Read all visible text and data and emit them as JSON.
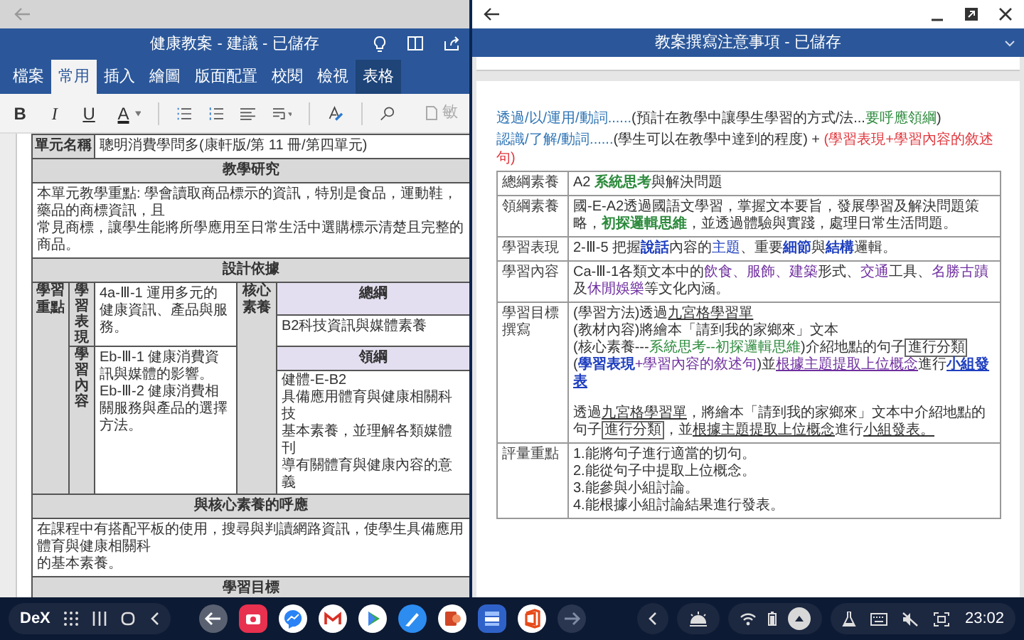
{
  "left_window": {
    "title": "健康教案 - 建議 - 已儲存",
    "tabs": [
      {
        "label": "檔案",
        "selected": false,
        "kind": "normal"
      },
      {
        "label": "常用",
        "selected": true,
        "kind": "normal"
      },
      {
        "label": "插入",
        "selected": false,
        "kind": "normal"
      },
      {
        "label": "繪圖",
        "selected": false,
        "kind": "normal"
      },
      {
        "label": "版面配置",
        "selected": false,
        "kind": "normal"
      },
      {
        "label": "校閱",
        "selected": false,
        "kind": "normal"
      },
      {
        "label": "檢視",
        "selected": false,
        "kind": "normal"
      },
      {
        "label": "表格",
        "selected": false,
        "kind": "contextual"
      }
    ],
    "ribbon": {
      "format_buttons": [
        "B",
        "I",
        "U",
        "A"
      ],
      "cut_label": "敏"
    },
    "document": {
      "unit_row": {
        "label": "單元名稱",
        "value": "聰明消費學問多(康軒版/第 11 冊/第四單元)"
      },
      "research": {
        "heading": "教學研究",
        "lines": [
          "本單元教學重點: 學會讀取商品標示的資訊，特別是食品，運動鞋，藥品的商標資訊，且",
          "常見商標，讓學生能將所學應用至日常生活中選購標示清楚且完整的商品。"
        ]
      },
      "design": {
        "heading": "設計依據",
        "focus_label": "學習重點",
        "core_label": "核心素養",
        "performance": {
          "label": "學習表現",
          "items": [
            "4a-Ⅲ-1 運用多元的健康資訊、產品與服務。"
          ]
        },
        "content": {
          "label": "學習內容",
          "items": [
            "Eb-Ⅲ-1 健康消費資訊與媒體的影響。",
            "Eb-Ⅲ-2 健康消費相關服務與產品的選擇方法。"
          ]
        },
        "general": {
          "heading": "總綱",
          "items": [
            "B2科技資訊與媒體素養"
          ]
        },
        "domain": {
          "heading": "領綱",
          "items": [
            "健體-E-B2",
            "具備應用體育與健康相關科技",
            "基本素養，並理解各類媒體刊",
            "導有關體育與健康內容的意義"
          ]
        }
      },
      "response": {
        "heading": "與核心素養的呼應",
        "lines": [
          "在課程中有搭配平板的使用，搜尋與判讀網路資訊，使學生具備應用體育與健康相關科",
          "的基本素養。"
        ]
      },
      "objectives": {
        "heading": "學習目標"
      }
    }
  },
  "right_window": {
    "title": "教案撰寫注意事項 - 已儲存",
    "guidelines": [
      {
        "segments": [
          {
            "text": "透過/以/運用/動詞......",
            "color": "#2e74b5",
            "kind": "plain"
          },
          {
            "text": "(預計在教學中讓學生學習的方式/法...",
            "color": "#333333",
            "kind": "plain"
          },
          {
            "text": "要呼應領綱",
            "color": "#2e8b3e",
            "kind": "plain"
          },
          {
            "text": ")",
            "color": "#333333",
            "kind": "plain"
          }
        ]
      },
      {
        "segments": [
          {
            "text": "認識/了解/動詞......",
            "color": "#2e74b5",
            "kind": "plain"
          },
          {
            "text": "(學生可以在教學中達到的程度) + ",
            "color": "#333333",
            "kind": "plain"
          },
          {
            "text": "(學習表現+學習內容的敘述句)",
            "color": "#e0383e",
            "kind": "plain"
          }
        ]
      }
    ],
    "table": [
      {
        "label": "總綱素養",
        "lines": [
          [
            {
              "text": "A2 ",
              "color": "#333333",
              "kind": "plain"
            },
            {
              "text": "**系統思考**",
              "color": "#2e8b3e",
              "kind": "plain"
            },
            {
              "text": "與解決問題",
              "color": "#333333",
              "kind": "plain"
            }
          ]
        ]
      },
      {
        "label": "領綱素養",
        "lines": [
          [
            {
              "text": "國-E-A2透過國語文學習，掌握文本要旨，發展學習及解決問題策略，",
              "color": "#333333",
              "kind": "plain"
            },
            {
              "text": "**初探邏輯思維**",
              "color": "#2e8b3e",
              "kind": "plain"
            },
            {
              "text": "，並透過體驗與實踐，處理日常生活問題。",
              "color": "#333333",
              "kind": "plain"
            }
          ]
        ]
      },
      {
        "label": "學習表現",
        "lines": [
          [
            {
              "text": "2-Ⅲ-5 把握",
              "color": "#333333",
              "kind": "plain"
            },
            {
              "text": "**說話**",
              "color": "#1f3fbf",
              "kind": "plain"
            },
            {
              "text": "內容的",
              "color": "#333333",
              "kind": "plain"
            },
            {
              "text": "主題",
              "color": "#1f3fbf",
              "kind": "plain"
            },
            {
              "text": "、重要",
              "color": "#333333",
              "kind": "plain"
            },
            {
              "text": "**細節**",
              "color": "#1f3fbf",
              "kind": "plain"
            },
            {
              "text": "與",
              "color": "#333333",
              "kind": "plain"
            },
            {
              "text": "**結構**",
              "color": "#1f3fbf",
              "kind": "plain"
            },
            {
              "text": "邏輯。",
              "color": "#333333",
              "kind": "plain"
            }
          ]
        ]
      },
      {
        "label": "學習內容",
        "lines": [
          [
            {
              "text": "Ca-Ⅲ-1各類文本中的",
              "color": "#333333",
              "kind": "plain"
            },
            {
              "text": "飲食、服飾、",
              "color": "#7030a0",
              "kind": "plain"
            },
            {
              "text": "建築",
              "color": "#7030a0",
              "kind": "plain"
            },
            {
              "text": "形式、",
              "color": "#333333",
              "kind": "plain"
            },
            {
              "text": "交通",
              "color": "#7030a0",
              "kind": "plain"
            },
            {
              "text": "工具、",
              "color": "#333333",
              "kind": "plain"
            },
            {
              "text": "名勝古蹟",
              "color": "#7030a0",
              "kind": "plain"
            },
            {
              "text": "及",
              "color": "#333333",
              "kind": "plain"
            },
            {
              "text": "休閒娛樂",
              "color": "#7030a0",
              "kind": "plain"
            },
            {
              "text": "等文化內涵。",
              "color": "#333333",
              "kind": "plain"
            }
          ]
        ]
      },
      {
        "label": "學習目標撰寫",
        "lines": [
          [
            {
              "text": "(學習方法)透過",
              "color": "#333333",
              "kind": "plain"
            },
            {
              "text": "九宮格學習單",
              "color": "#333333",
              "kind": "underline"
            }
          ],
          [
            {
              "text": "(教材內容)將繪本「請到我的家鄉來」文本",
              "color": "#333333",
              "kind": "plain"
            }
          ],
          [
            {
              "text": "(核心素養---",
              "color": "#333333",
              "kind": "plain"
            },
            {
              "text": "系統思考--初探邏輯思維",
              "color": "#2e8b3e",
              "kind": "plain"
            },
            {
              "text": ")介紹地點的句子",
              "color": "#333333",
              "kind": "plain"
            },
            {
              "text": "進行分類",
              "color": "#333333",
              "kind": "boxed"
            }
          ],
          [
            {
              "text": "(",
              "color": "#333333",
              "kind": "plain"
            },
            {
              "text": "**學習表現**",
              "color": "#1f3fbf",
              "kind": "plain"
            },
            {
              "text": "+學習內容的敘述句",
              "color": "#7030a0",
              "kind": "plain"
            },
            {
              "text": ")並",
              "color": "#333333",
              "kind": "plain"
            },
            {
              "text": "根據主題提取上位概念",
              "color": "#7030a0",
              "kind": "underline"
            },
            {
              "text": "進行",
              "color": "#333333",
              "kind": "plain"
            },
            {
              "text": "**小組發表**",
              "color": "#1f3fbf",
              "kind": "underline"
            }
          ]
        ],
        "summary": [
          {
            "text": "透過",
            "color": "#333333",
            "kind": "plain"
          },
          {
            "text": "九宮格學習單",
            "color": "#333333",
            "kind": "underline"
          },
          {
            "text": "，將繪本「請到我的家鄉來」文本中介紹地點的句子",
            "color": "#333333",
            "kind": "plain"
          },
          {
            "text": "進行分類",
            "color": "#333333",
            "kind": "boxed"
          },
          {
            "text": "，並",
            "color": "#333333",
            "kind": "plain"
          },
          {
            "text": "根據主題提取上位概念",
            "color": "#333333",
            "kind": "underline"
          },
          {
            "text": "進行",
            "color": "#333333",
            "kind": "plain"
          },
          {
            "text": "小組發表。",
            "color": "#333333",
            "kind": "underline"
          }
        ]
      },
      {
        "label": "評量重點",
        "lines": [
          [
            {
              "text": "1.能將句子進行適當的切句。",
              "color": "#333333",
              "kind": "plain"
            }
          ],
          [
            {
              "text": "2.能從句子中提取上位概念。",
              "color": "#333333",
              "kind": "plain"
            }
          ],
          [
            {
              "text": "3.能參與小組討論。",
              "color": "#333333",
              "kind": "plain"
            }
          ],
          [
            {
              "text": "4.能根據小組討論結果進行發表。",
              "color": "#333333",
              "kind": "plain"
            }
          ]
        ]
      }
    ]
  },
  "taskbar": {
    "label": "DeX",
    "clock": "23:02"
  }
}
